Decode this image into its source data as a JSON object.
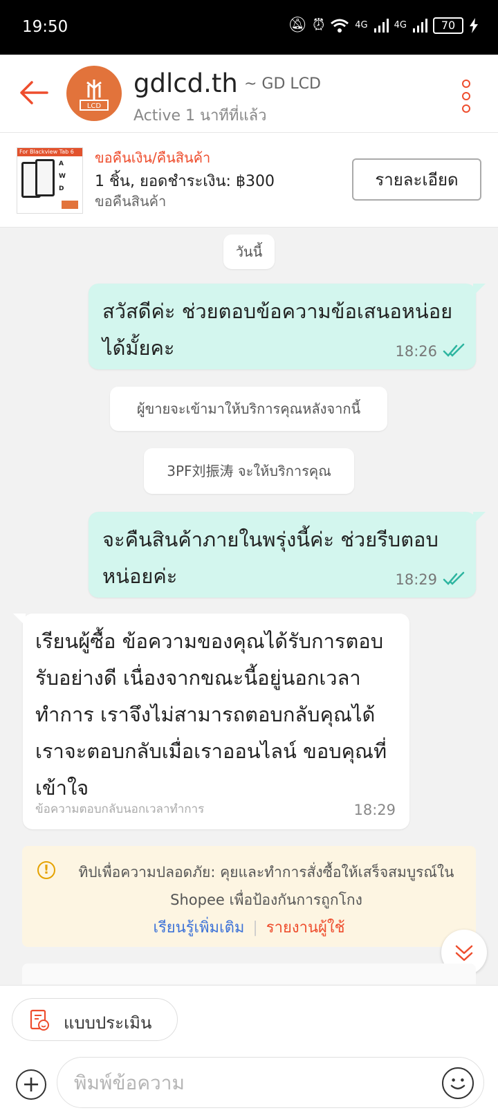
{
  "status": {
    "time": "19:50",
    "battery": "70",
    "network": "4G"
  },
  "header": {
    "shop_name": "gdlcd.th",
    "shop_alias": "~ GD LCD",
    "active": "Active 1 นาทีที่แล้ว",
    "avatar_text": "LCD"
  },
  "order": {
    "status": "ขอคืนเงิน/คืนสินค้า",
    "summary": "1 ชิ้น, ยอดชำระเงิน: ฿300",
    "sub": "ขอคืนสินค้า",
    "details_button": "รายละเอียด",
    "thumb_text": "For Blackview Tab 6",
    "thumb_labels": [
      "A",
      "W",
      "D"
    ]
  },
  "chat": {
    "date_label": "วันนี้",
    "messages": [
      {
        "text": "สวัสดีค่ะ ช่วยตอบข้อความข้อเสนอหน่อยได้มั้ยคะ",
        "time": "18:26"
      },
      {
        "text": "ผู้ขายจะเข้ามาให้บริการคุณหลังจากนี้"
      },
      {
        "text": "3PF刘振涛 จะให้บริการคุณ"
      },
      {
        "text": "จะคืนสินค้าภายในพรุ่งนี้ค่ะ ช่วยรีบตอบหน่อยค่ะ",
        "time": "18:29"
      },
      {
        "text": "เรียนผู้ซื้อ ข้อความของคุณได้รับการตอบรับอย่างดี เนื่องจากขณะนี้อยู่นอกเวลาทำการ เราจึงไม่สามารถตอบกลับคุณได้ เราจะตอบกลับเมื่อเราออนไลน์ ขอบคุณที่เข้าใจ",
        "note": "ข้อความตอบกลับนอกเวลาทำการ",
        "time": "18:29"
      }
    ]
  },
  "tip": {
    "text": "ทิปเพื่อความปลอดภัย: คุยและทำการสั่งซื้อให้เสร็จสมบูรณ์ใน Shopee เพื่อป้องกันการถูกโกง",
    "learn_more": "เรียนรู้เพิ่มเติม",
    "report": "รายงานผู้ใช้"
  },
  "footer": {
    "rate_button": "แบบประเมิน",
    "input_placeholder": "พิมพ์ข้อความ"
  },
  "colors": {
    "accent": "#ee4d2d",
    "bubble_out": "#d3f6ee",
    "tip_bg": "#fdf5e2",
    "link": "#3d72d8"
  },
  "icons": [
    "back-arrow-icon",
    "more-vertical-icon",
    "double-check-icon",
    "warning-icon",
    "chevron-double-down-icon",
    "rating-form-icon",
    "plus-icon",
    "emoji-icon"
  ]
}
